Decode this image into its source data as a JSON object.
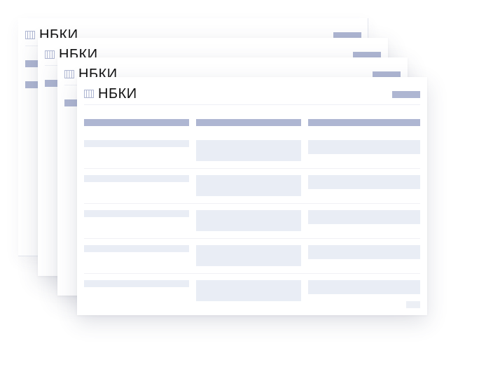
{
  "brand": {
    "name": "НБКИ",
    "icon": "book-icon"
  },
  "colors": {
    "accent": "#aeb6d2",
    "light_block": "#e9edf5",
    "separator": "#f0f1f5"
  },
  "cards": [
    {
      "name": "НБКИ"
    },
    {
      "name": "НБКИ"
    },
    {
      "name": "НБКИ"
    },
    {
      "name": "НБКИ"
    }
  ]
}
